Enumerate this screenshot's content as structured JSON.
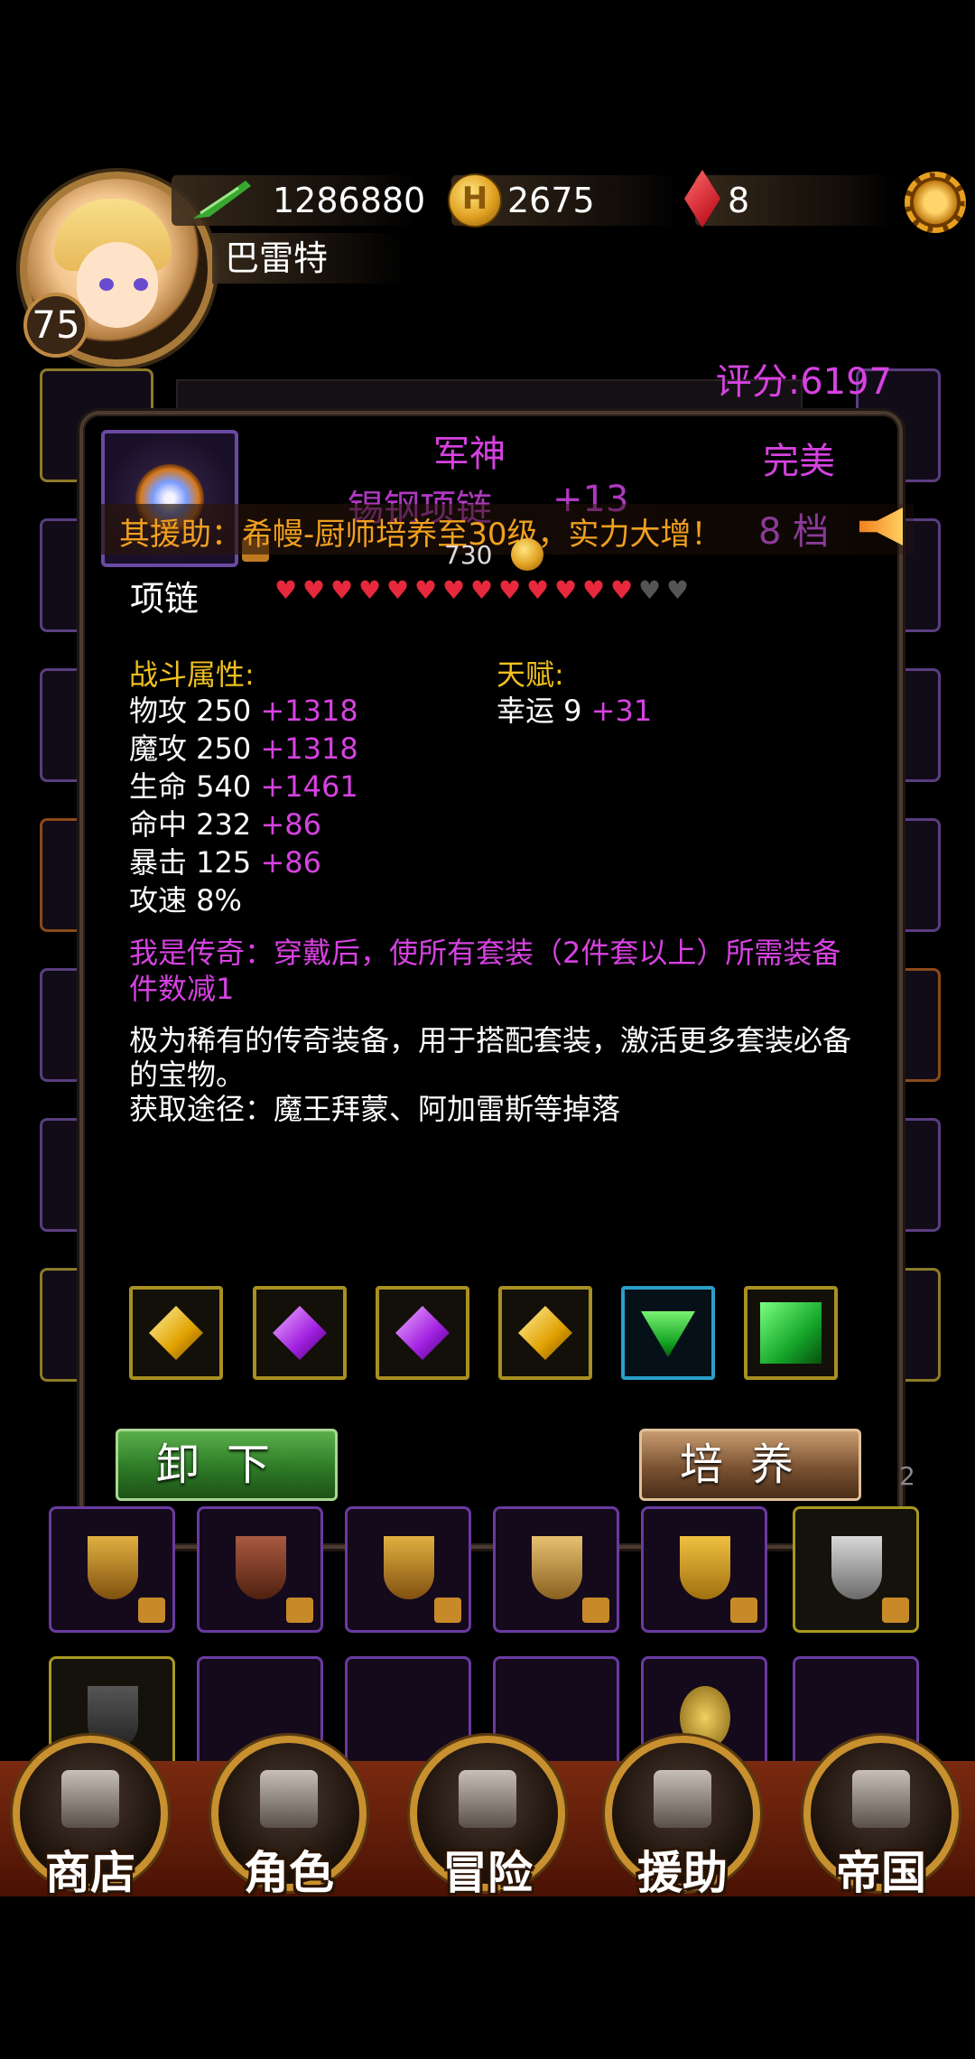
{
  "header": {
    "power": "1286880",
    "gold": "2675",
    "gems": "8",
    "player_name": "巴雷特",
    "level": "75"
  },
  "score_label": "评分:6197",
  "item": {
    "title": "军神",
    "name": "锡钢项链",
    "enhance": "+13",
    "quality": "完美",
    "grade": "8 档",
    "price": "730",
    "type": "项链",
    "hearts_on": 13,
    "hearts_total": 15
  },
  "announcement": "其援助：希幔-厨师培养至30级，实力大增！",
  "combat": {
    "title": "战斗属性:",
    "stats": [
      {
        "label": "物攻 250",
        "bonus": "+1318"
      },
      {
        "label": "魔攻 250",
        "bonus": "+1318"
      },
      {
        "label": "生命 540",
        "bonus": "+1461"
      },
      {
        "label": "命中 232",
        "bonus": "+86"
      },
      {
        "label": "暴击 125",
        "bonus": "+86"
      },
      {
        "label": "攻速 8%",
        "bonus": ""
      }
    ]
  },
  "talent": {
    "title": "天赋:",
    "stats": [
      {
        "label": "幸运 9",
        "bonus": "+31"
      }
    ]
  },
  "legend_text": "我是传奇：穿戴后，使所有套装（2件套以上）所需装备件数减1",
  "description": "极为稀有的传奇装备，用于搭配套装，激活更多套装必备的宝物。",
  "source": "获取途径：魔王拜蒙、阿加雷斯等掉落",
  "sockets": [
    "yellow-diamond-gem",
    "purple-diamond-gem",
    "purple-diamond-gem",
    "yellow-diamond-gem",
    "green-triangle-gem",
    "green-square-gem"
  ],
  "buttons": {
    "unequip": "卸下",
    "train": "培养"
  },
  "page_indicator": "2",
  "nav": [
    {
      "label": "商店",
      "icon": "castle-icon"
    },
    {
      "label": "角色",
      "icon": "hooded-figure-icon"
    },
    {
      "label": "冒险",
      "icon": "dungeon-gate-icon"
    },
    {
      "label": "援助",
      "icon": "girl-portrait-icon"
    },
    {
      "label": "帝国",
      "icon": "crown-icon"
    }
  ],
  "colors": {
    "accent_purple": "#d642e0",
    "gold_text": "#f0c020",
    "announce_orange": "#f0a020",
    "heart_red": "#e8283c"
  }
}
